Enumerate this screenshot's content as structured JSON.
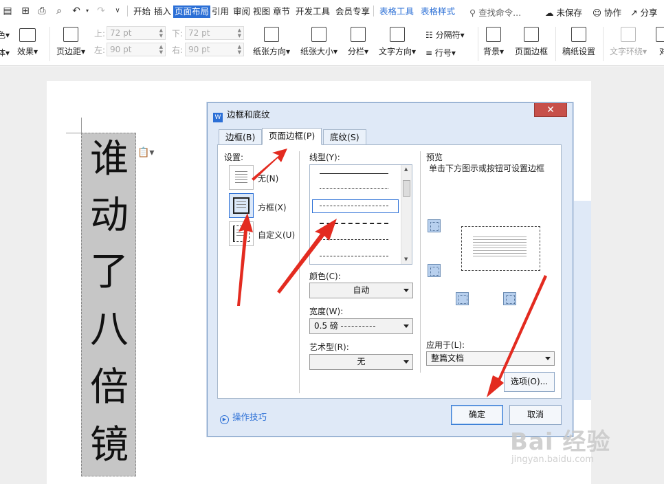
{
  "menubar": {
    "tabs": [
      "开始",
      "插入",
      "页面布局",
      "引用",
      "审阅",
      "视图",
      "章节",
      "开发工具",
      "会员专享"
    ],
    "context_tabs": [
      "表格工具",
      "表格样式"
    ],
    "search_placeholder": "查找命令...",
    "right_actions": [
      "未保存",
      "协作",
      "分享"
    ]
  },
  "ribbon": {
    "left_labels": [
      "色▾",
      "体▾",
      "效果▾"
    ],
    "margin_button": "页边距",
    "margins": {
      "top_label": "上:",
      "top_value": "72 pt",
      "bottom_label": "下:",
      "bottom_value": "72 pt",
      "left_label": "左:",
      "left_value": "90 pt",
      "right_label": "右:",
      "right_value": "90 pt"
    },
    "buttons": [
      "纸张方向",
      "纸张大小",
      "分栏",
      "文字方向"
    ],
    "separator": "分隔符",
    "line_number": "行号",
    "buttons2": [
      "背景",
      "页面边框",
      "稿纸设置",
      "文字环绕",
      "对"
    ]
  },
  "document": {
    "vertical_chars": [
      "谁",
      "动",
      "了",
      "八",
      "倍",
      "镜"
    ]
  },
  "dialog": {
    "title": "边框和底纹",
    "tabs": [
      "边框(B)",
      "页面边框(P)",
      "底纹(S)"
    ],
    "active_tab": 1,
    "settings_label": "设置:",
    "settings": [
      "无(N)",
      "方框(X)",
      "自定义(U)"
    ],
    "line_style_label": "线型(Y):",
    "color_label": "颜色(C):",
    "color_value": "自动",
    "width_label": "宽度(W):",
    "width_value": "0.5 磅",
    "art_label": "艺术型(R):",
    "art_value": "无",
    "preview_label": "预览",
    "preview_hint": "单击下方图示或按钮可设置边框",
    "apply_label": "应用于(L):",
    "apply_value": "整篇文档",
    "options_button": "选项(O)...",
    "tips_link": "操作技巧",
    "ok_button": "确定",
    "cancel_button": "取消"
  },
  "watermark": {
    "logo": "Bai 经验",
    "site": "jingyan.baidu.com"
  }
}
